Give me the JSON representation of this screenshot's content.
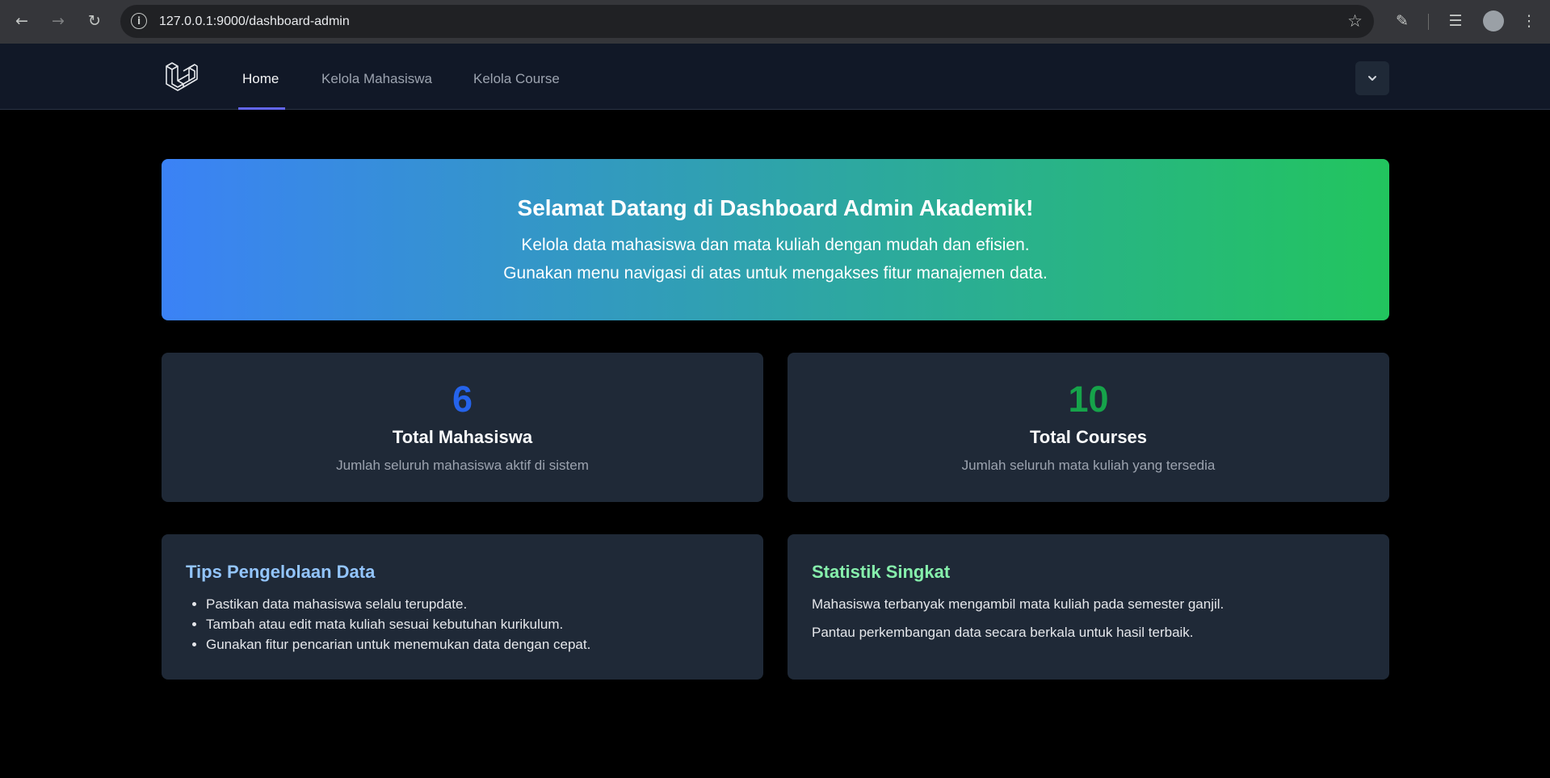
{
  "browser": {
    "url": "127.0.0.1:9000/dashboard-admin",
    "icons": [
      "back-icon",
      "forward-icon",
      "reload-icon",
      "site-info-icon",
      "bookmark-star-icon",
      "extensions-icon",
      "media-queue-icon",
      "profile-avatar",
      "menu-kebab-icon"
    ]
  },
  "nav": {
    "links": [
      {
        "label": "Home",
        "active": true
      },
      {
        "label": "Kelola Mahasiswa",
        "active": false
      },
      {
        "label": "Kelola Course",
        "active": false
      }
    ],
    "accent": "#6366f1"
  },
  "hero": {
    "title": "Selamat Datang di Dashboard Admin Akademik!",
    "line1": "Kelola data mahasiswa dan mata kuliah dengan mudah dan efisien.",
    "line2": "Gunakan menu navigasi di atas untuk mengakses fitur manajemen data.",
    "gradient_from": "#3b82f6",
    "gradient_to": "#22c55e"
  },
  "stats": [
    {
      "number": "6",
      "title": "Total Mahasiswa",
      "desc": "Jumlah seluruh mahasiswa aktif di sistem",
      "color": "#2563eb"
    },
    {
      "number": "10",
      "title": "Total Courses",
      "desc": "Jumlah seluruh mata kuliah yang tersedia",
      "color": "#16a34a"
    }
  ],
  "tips": {
    "title": "Tips Pengelolaan Data",
    "color": "#93c5fd",
    "items": [
      "Pastikan data mahasiswa selalu terupdate.",
      "Tambah atau edit mata kuliah sesuai kebutuhan kurikulum.",
      "Gunakan fitur pencarian untuk menemukan data dengan cepat."
    ]
  },
  "statistik": {
    "title": "Statistik Singkat",
    "color": "#86efac",
    "para1": "Mahasiswa terbanyak mengambil mata kuliah pada semester ganjil.",
    "para2": "Pantau perkembangan data secara berkala untuk hasil terbaik."
  }
}
